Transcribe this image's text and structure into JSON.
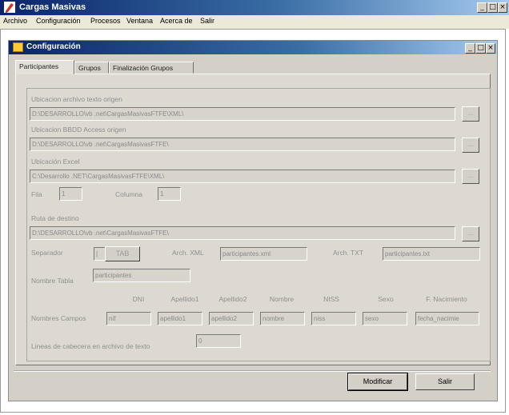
{
  "app": {
    "title": "Cargas Masivas"
  },
  "menu": [
    "Archivo",
    "Configuración",
    "Procesos",
    "Ventana",
    "Acerca de",
    "Salir"
  ],
  "window_buttons": {
    "minimize": "_",
    "maximize": "□",
    "close": "×"
  },
  "child": {
    "title": "Configuración"
  },
  "tabs": [
    "Participantes",
    "Grupos",
    "Finalización Grupos"
  ],
  "form": {
    "archivo_texto_label": "Ubicacion archivo texto origen",
    "archivo_texto_value": "D:\\DESARROLLO\\vb .net\\CargasMasivasFTFE\\XML\\",
    "bbdd_label": "Ubicacion BBDD Access origen",
    "bbdd_value": "D:\\DESARROLLO\\vb .net\\CargasMasivasFTFE\\",
    "excel_label": "Ubicación Excel",
    "excel_value": "C:\\Desarrollo .NET\\CargasMasivasFTFE\\XML\\",
    "fila_label": "Fila",
    "fila_value": "1",
    "columna_label": "Columna",
    "columna_value": "1",
    "destino_label": "Ruta de destino",
    "destino_value": "D:\\DESARROLLO\\vb .net\\CargasMasivasFTFE\\",
    "separador_label": "Separador",
    "separador_value": "|",
    "tab_button": "TAB",
    "xml_label": "Arch. XML",
    "xml_value": "participantes.xml",
    "txt_label": "Arch. TXT",
    "txt_value": "participantes.txt",
    "tabla_label": "Nombre Tabla",
    "tabla_value": "participantes",
    "campos_label": "Nombres Campos",
    "campos_headers": [
      "DNI",
      "Apellido1",
      "Apellido2",
      "Nombre",
      "NISS",
      "Sexo",
      "F. Nacimiento"
    ],
    "campos_values": [
      "nif",
      "apellido1",
      "apellido2",
      "nombre",
      "niss",
      "sexo",
      "fecha_nacimie"
    ],
    "lineas_label": "Lineas de cabecera en archivo de texto",
    "lineas_value": "0",
    "browse": "..."
  },
  "buttons": {
    "modificar": "Modificar",
    "salir": "Salir"
  }
}
